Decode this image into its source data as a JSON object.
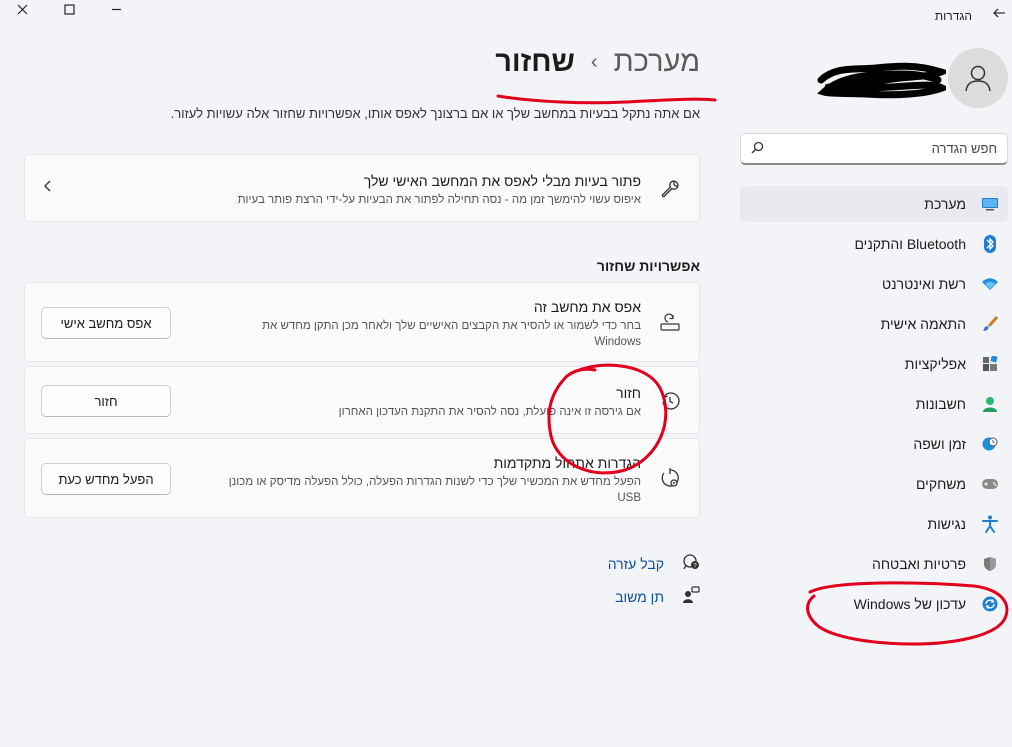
{
  "window": {
    "title": "הגדרות",
    "controls": [
      "minimize",
      "maximize",
      "close"
    ]
  },
  "search": {
    "placeholder": "חפש הגדרה"
  },
  "sidebar": {
    "items": [
      {
        "label": "מערכת",
        "icon": "system-icon",
        "active": true
      },
      {
        "label": "Bluetooth והתקנים",
        "icon": "bluetooth-icon"
      },
      {
        "label": "רשת ואינטרנט",
        "icon": "network-icon"
      },
      {
        "label": "התאמה אישית",
        "icon": "brush-icon"
      },
      {
        "label": "אפליקציות",
        "icon": "apps-icon"
      },
      {
        "label": "חשבונות",
        "icon": "account-icon"
      },
      {
        "label": "זמן ושפה",
        "icon": "globe-clock-icon"
      },
      {
        "label": "משחקים",
        "icon": "gamepad-icon"
      },
      {
        "label": "נגישות",
        "icon": "accessibility-icon"
      },
      {
        "label": "פרטיות ואבטחה",
        "icon": "shield-icon"
      },
      {
        "label": "עדכון של Windows",
        "icon": "windows-update-icon"
      }
    ]
  },
  "header": {
    "parent": "מערכת",
    "separator": "›",
    "current": "שחזור",
    "subtitle": "אם אתה נתקל בבעיות במחשב שלך או אם ברצונך לאפס אותו, אפשרויות שחזור אלה עשויות לעזור."
  },
  "troubleshoot": {
    "title": "פתור בעיות מבלי לאפס את המחשב האישי שלך",
    "desc": "איפוס עשוי להימשך זמן מה - נסה תחילה לפתור את הבעיות על-ידי הרצת פותר בעיות"
  },
  "recovery_options": {
    "heading": "אפשרויות שחזור",
    "items": [
      {
        "title": "אפס את מחשב זה",
        "desc": "בחר כדי לשמור או להסיר את הקבצים האישיים שלך ולאחר מכן התקן מחדש את Windows",
        "button": "אפס מחשב אישי"
      },
      {
        "title": "חזור",
        "desc": "אם גירסה זו אינה פועלת, נסה להסיר את התקנת העדכון האחרון",
        "button": "חזור"
      },
      {
        "title": "הגדרות אתחול מתקדמות",
        "desc": "הפעל מחדש את המכשיר שלך כדי לשנות הגדרות הפעלה, כולל הפעלה מדיסק או מכונן USB",
        "button": "הפעל מחדש כעת"
      }
    ]
  },
  "links": {
    "help": "קבל עזרה",
    "feedback": "תן משוב"
  },
  "colors": {
    "accent": "#0a4f9e",
    "annotation": "#e0001b",
    "background": "#f3f4f8"
  }
}
